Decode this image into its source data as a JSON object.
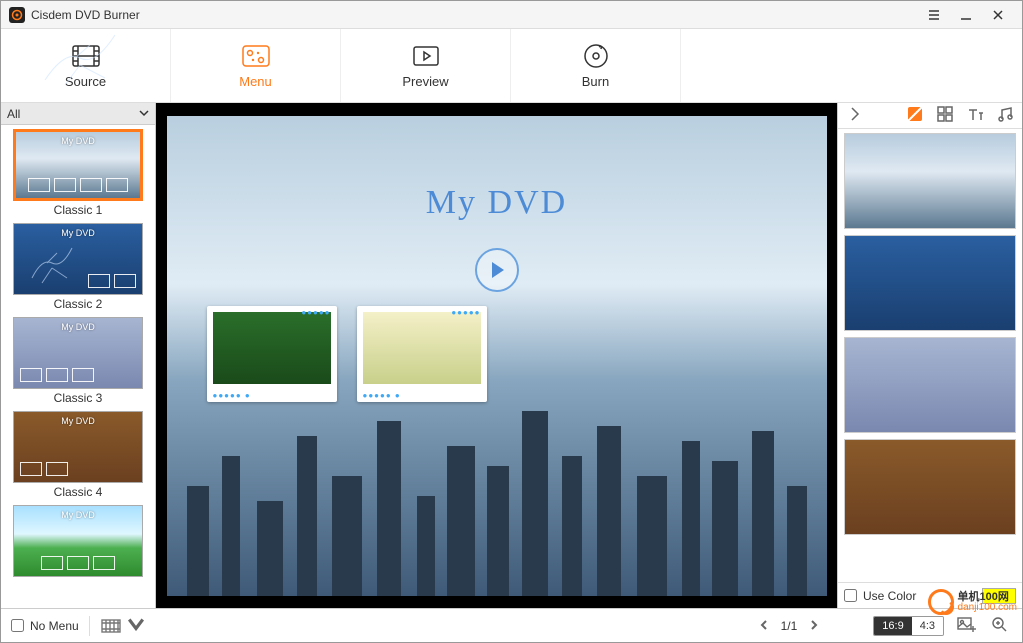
{
  "titlebar": {
    "title": "Cisdem DVD Burner"
  },
  "nav": {
    "source": "Source",
    "menu": "Menu",
    "preview": "Preview",
    "burn": "Burn",
    "active": "menu"
  },
  "left_panel": {
    "filter_label": "All",
    "templates": [
      {
        "label": "Classic 1",
        "selected": true,
        "bg": "bg-city"
      },
      {
        "label": "Classic 2",
        "selected": false,
        "bg": "bg-runner"
      },
      {
        "label": "Classic 3",
        "selected": false,
        "bg": "bg-crystal"
      },
      {
        "label": "Classic 4",
        "selected": false,
        "bg": "bg-wood"
      },
      {
        "label": "",
        "selected": false,
        "bg": "bg-grass"
      }
    ],
    "thumb_title": "My DVD"
  },
  "stage": {
    "title": "My DVD"
  },
  "right_panel": {
    "use_color_label": "Use Color",
    "use_color_checked": false,
    "color_value": "#ffff00",
    "backgrounds": [
      {
        "bg": "bg-city"
      },
      {
        "bg": "bg-runner"
      },
      {
        "bg": "bg-crystal"
      },
      {
        "bg": "bg-wood"
      }
    ]
  },
  "bottom": {
    "no_menu_label": "No Menu",
    "no_menu_checked": false,
    "page_current": "1",
    "page_total": "1",
    "page_display": "1/1",
    "ratio_169": "16:9",
    "ratio_43": "4:3",
    "ratio_active": "16:9"
  },
  "watermark": {
    "line1": "单机100网",
    "line2": "danji100.com"
  }
}
